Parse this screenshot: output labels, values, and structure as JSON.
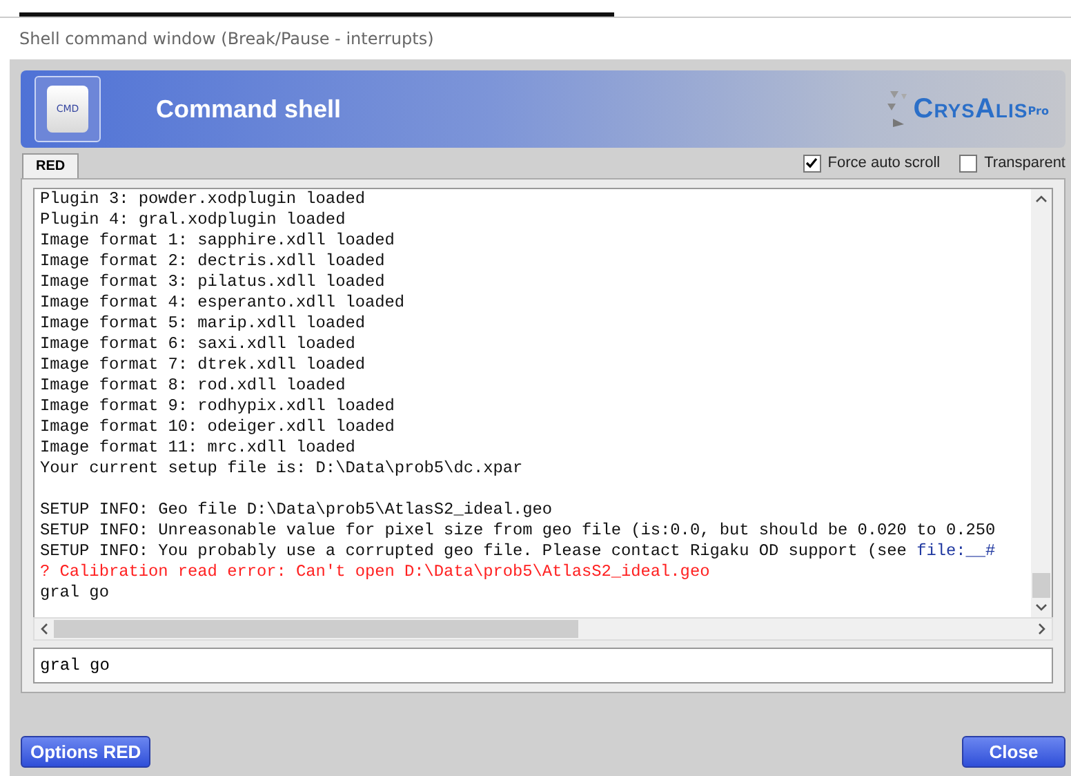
{
  "window": {
    "title": "Shell command window (Break/Pause - interrupts)"
  },
  "header": {
    "title": "Command shell",
    "icon_label": "CMD",
    "logo": "CrysAlis",
    "logo_sup": "Pro"
  },
  "tabs": [
    {
      "label": "RED",
      "selected": true
    }
  ],
  "options": [
    {
      "label": "Force auto scroll",
      "checked": true
    },
    {
      "label": "Transparent",
      "checked": false
    }
  ],
  "output": [
    {
      "kind": "info",
      "text": "Plugin 3: powder.xodplugin loaded"
    },
    {
      "kind": "info",
      "text": "Plugin 4: gral.xodplugin loaded"
    },
    {
      "kind": "info",
      "text": "Image format 1: sapphire.xdll loaded"
    },
    {
      "kind": "info",
      "text": "Image format 2: dectris.xdll loaded"
    },
    {
      "kind": "info",
      "text": "Image format 3: pilatus.xdll loaded"
    },
    {
      "kind": "info",
      "text": "Image format 4: esperanto.xdll loaded"
    },
    {
      "kind": "info",
      "text": "Image format 5: marip.xdll loaded"
    },
    {
      "kind": "info",
      "text": "Image format 6: saxi.xdll loaded"
    },
    {
      "kind": "info",
      "text": "Image format 7: dtrek.xdll loaded"
    },
    {
      "kind": "info",
      "text": "Image format 8: rod.xdll loaded"
    },
    {
      "kind": "info",
      "text": "Image format 9: rodhypix.xdll loaded"
    },
    {
      "kind": "info",
      "text": "Image format 10: odeiger.xdll loaded"
    },
    {
      "kind": "info",
      "text": "Image format 11: mrc.xdll loaded"
    },
    {
      "kind": "info",
      "text": "Your current setup file is: D:\\Data\\prob5\\dc.xpar"
    },
    {
      "kind": "blank"
    },
    {
      "kind": "info",
      "text": "SETUP INFO: Geo file D:\\Data\\prob5\\AtlasS2_ideal.geo"
    },
    {
      "kind": "info",
      "text": "SETUP INFO: Unreasonable value for pixel size from geo file (is:0.0, but should be 0.020 to 0.250"
    },
    {
      "kind": "info",
      "text": "SETUP INFO: You probably use a corrupted geo file. Please contact Rigaku OD support (see ",
      "link": "file:__#"
    },
    {
      "kind": "error",
      "text": "? Calibration read error: Can't open D:\\Data\\prob5\\AtlasS2_ideal.geo"
    },
    {
      "kind": "info",
      "text": "gral go"
    }
  ],
  "command_input": {
    "value": "gral go"
  },
  "buttons": [
    {
      "label": "Options RED"
    },
    {
      "label": "Close"
    }
  ]
}
